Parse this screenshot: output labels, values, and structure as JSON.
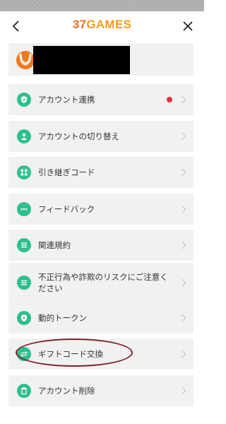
{
  "header": {
    "logo_num": "37",
    "logo_word": "GAMES",
    "back_icon": "chevron-left-icon",
    "close_icon": "close-icon"
  },
  "colors": {
    "accent_green": "#2fbf8e",
    "card_bg": "#f1f1f1",
    "badge_red": "#e5303a",
    "annotation": "#7b1f2a"
  },
  "menu": [
    {
      "label": "アカウント連携",
      "icon": "shield-check-icon",
      "badge": true
    },
    {
      "label": "アカウントの切り替え",
      "icon": "user-icon",
      "badge": false
    },
    {
      "label": "引き継ぎコード",
      "icon": "grid-icon",
      "badge": false
    },
    {
      "label": "フィードバック",
      "icon": "chat-dots-icon",
      "badge": false
    },
    {
      "label": "関連規約",
      "icon": "list-icon",
      "badge": false
    },
    {
      "label": "不正行為や詐欺のリスクにご注意ください",
      "icon": "list-icon",
      "badge": false
    },
    {
      "label": "動的トークン",
      "icon": "shield-icon",
      "badge": false
    },
    {
      "label": "ギフトコード交換",
      "icon": "exchange-icon",
      "badge": false
    },
    {
      "label": "アカウント削除",
      "icon": "trash-icon",
      "badge": false
    }
  ]
}
